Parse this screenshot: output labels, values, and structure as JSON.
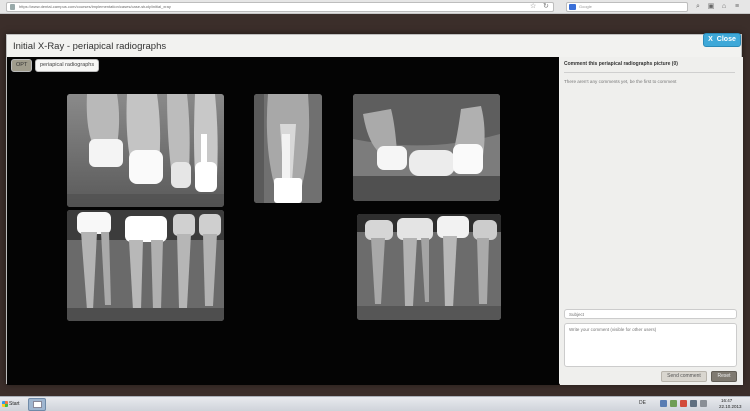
{
  "browser": {
    "url": "https://www.dental-campus.com/courses/implementation/cases/case-study/initial_xray",
    "search_placeholder": "Google",
    "icons": [
      "star-icon",
      "refresh-icon",
      "home-icon",
      "bookmark-icon",
      "menu-icon"
    ]
  },
  "modal": {
    "title": "Initial X-Ray - periapical radiographs",
    "close_icon": "X",
    "close_label": "Close",
    "tabs": [
      {
        "label": "OPT",
        "active": false
      },
      {
        "label": "periapical radiographs",
        "active": true
      }
    ],
    "accent_color": "#3ea8d8"
  },
  "comments": {
    "header": "Comment this periapical radiographs picture (0)",
    "empty_text": "There aren't any comments yet, be the first to comment",
    "subject_placeholder": "Subject",
    "comment_placeholder": "Write your comment (visible for other users)",
    "send_label": "Send comment",
    "reset_label": "Reset"
  },
  "taskbar": {
    "start_label": "Start",
    "language": "DE",
    "time": "16:47",
    "date": "22.10.2013"
  }
}
